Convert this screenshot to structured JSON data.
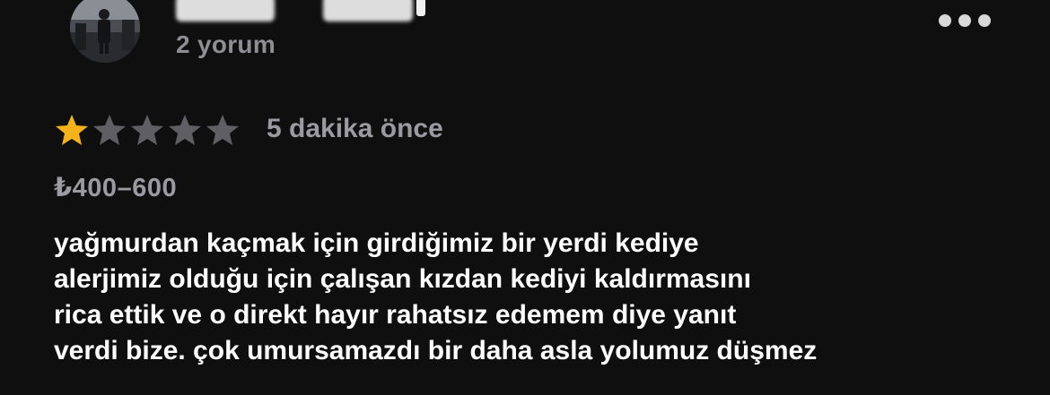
{
  "reviewer": {
    "review_count": "2 yorum",
    "avatar_icon": "profile-photo"
  },
  "menu": {
    "more_icon": "ellipsis-icon"
  },
  "rating": {
    "value": 1,
    "max": 5,
    "filled_color": "#f5b21b",
    "empty_color": "#5e5e63"
  },
  "time_ago": "5 dakika önce",
  "price_range": "₺400–600",
  "review": {
    "lines": [
      "yağmurdan kaçmak için girdiğimiz bir yerdi kediye",
      "alerjimiz olduğu için çalışan kızdan kediyi kaldırmasını",
      "rica ettik ve o direkt hayır rahatsız edemem diye yanıt",
      "verdi bize. çok umursamazdı bir daha asla yolumuz düşmez"
    ]
  }
}
